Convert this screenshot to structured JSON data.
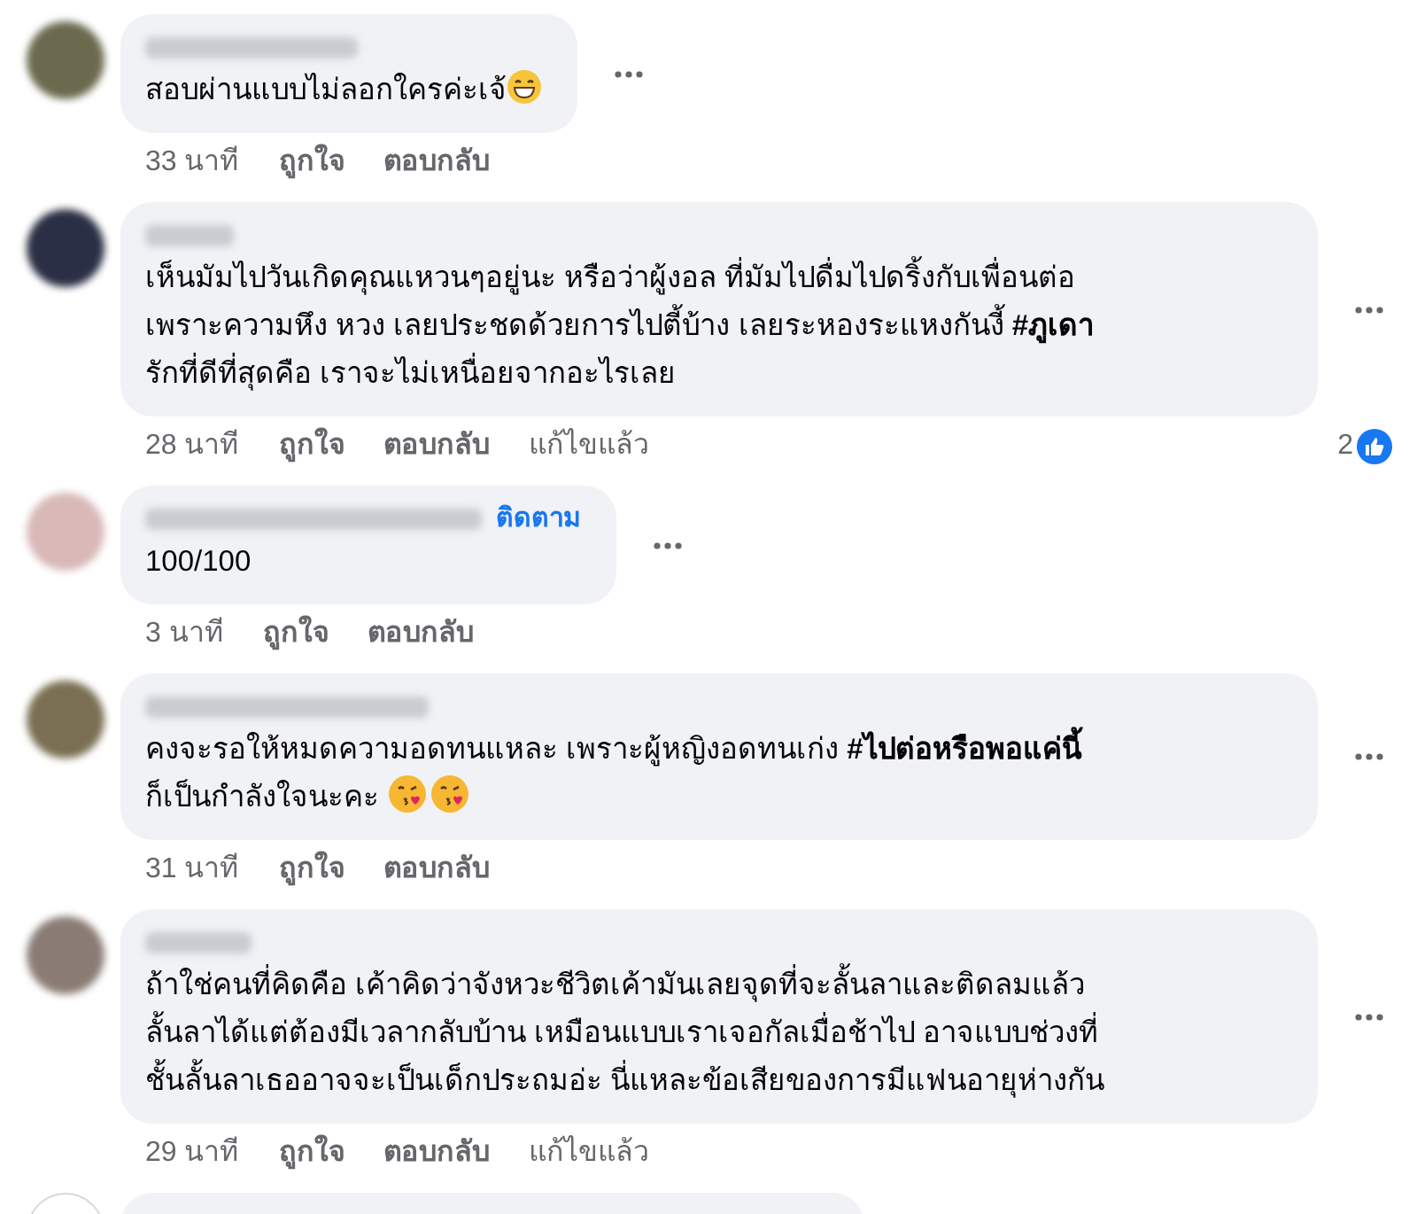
{
  "comments": [
    {
      "text_lines": [
        "สอบผ่านแบบไม่ลอกใครค่ะเจ้"
      ],
      "emojis": [
        {
          "kind": "grin"
        }
      ],
      "time": "33 นาที",
      "actions": [
        "ถูกใจ",
        "ตอบกลับ"
      ]
    },
    {
      "text_lines": [
        "เห็นมัมไปวันเกิดคุณแหวนๆอยู่นะ หรือว่าผู้งอล ที่มัมไปดื่มไปดริ้งกับเพื่อนต่อ",
        "เพราะความหึง หวง เลยประชดด้วยการไปตี้บ้าง เลยระหองระแหงกันงี้ **#ภูเดา**",
        "รักที่ดีที่สุดคือ เราจะไม่เหนื่อยจากอะไรเลย"
      ],
      "time": "28 นาที",
      "actions": [
        "ถูกใจ",
        "ตอบกลับ"
      ],
      "edited_label": "แก้ไขแล้ว",
      "reaction_count": "2"
    },
    {
      "follow_label": "ติดตาม",
      "text_lines": [
        "100/100"
      ],
      "time": "3 นาที",
      "actions": [
        "ถูกใจ",
        "ตอบกลับ"
      ]
    },
    {
      "text_lines": [
        "คงจะรอให้หมดความอดทนแหละ เพราะผู้หญิงอดทนเก่ง **#ไปต่อหรือพอแค่นี้**",
        "ก็เป็นกำลังใจนะคะ "
      ],
      "emojis": [
        {
          "kind": "kiss"
        },
        {
          "kind": "kiss"
        }
      ],
      "time": "31 นาที",
      "actions": [
        "ถูกใจ",
        "ตอบกลับ"
      ]
    },
    {
      "text_lines": [
        "ถ้าใช่คนที่คิดคือ เค้าคิดว่าจังหวะชีวิตเค้ามันเลยจุดที่จะลั้นลาและติดลมแล้ว",
        "ลั้นลาได้แต่ต้องมีเวลากลับบ้าน เหมือนแบบเราเจอกัลเมื่อช้าไป อาจแบบช่วงที่",
        "ชั้นลั้นลาเธออาจจะเป็นเด็กประถมอ่ะ นี่แหละข้อเสียของการมีแฟนอายุห่างกัน"
      ],
      "time": "29 นาที",
      "actions": [
        "ถูกใจ",
        "ตอบกลับ"
      ],
      "edited_label": "แก้ไขแล้ว"
    }
  ]
}
